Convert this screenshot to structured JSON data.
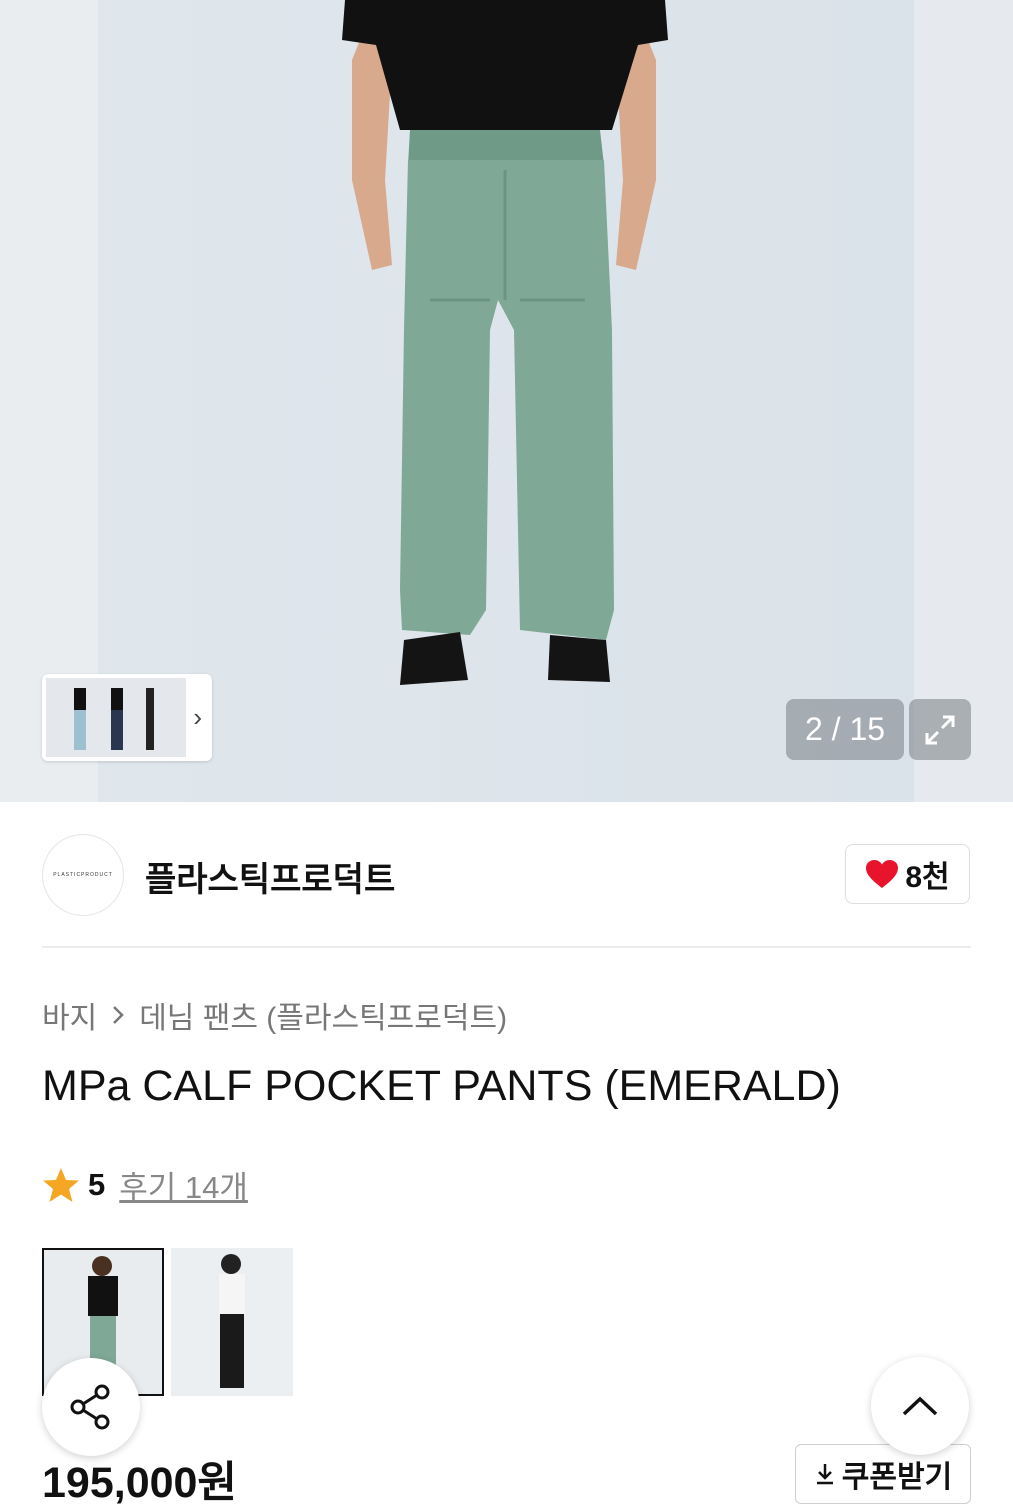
{
  "gallery": {
    "counter": "2 / 15",
    "icons": {
      "expand": "expand-icon",
      "next": "chevron-right-icon"
    },
    "colors": {
      "background": "#dbe3ea",
      "pants": "#7fa896",
      "shirt": "#111111"
    }
  },
  "brand": {
    "name": "플라스틱프로덕트",
    "logo_text": "PLASTICPRODUCT",
    "likes": "8천",
    "like_color": "#e8142b"
  },
  "breadcrumb": {
    "items": [
      "바지",
      "데님 팬츠 (플라스틱프로덕트)"
    ],
    "separator_icon": "chevron-right-icon"
  },
  "product": {
    "title": "MPa CALF POCKET PANTS (EMERALD)",
    "rating": "5",
    "reviews": "후기 14개",
    "star_color": "#f5a623",
    "price": "195,000원",
    "coupon_label": "쿠폰받기"
  },
  "actions": {
    "share_icon": "share-icon",
    "scroll_top_icon": "chevron-up-icon"
  }
}
